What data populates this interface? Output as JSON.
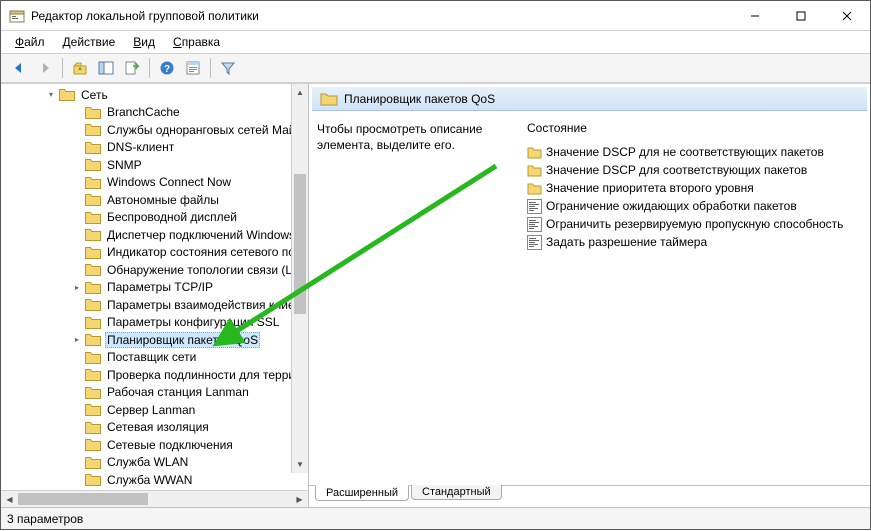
{
  "window": {
    "title": "Редактор локальной групповой политики"
  },
  "menu": {
    "file": "Файл",
    "action": "Действие",
    "view": "Вид",
    "help": "Справка"
  },
  "tree": {
    "root": "Сеть",
    "items": [
      "BranchCache",
      "Службы одноранговых сетей Май",
      "DNS-клиент",
      "SNMP",
      "Windows Connect Now",
      "Автономные файлы",
      "Беспроводной дисплей",
      "Диспетчер подключений Windows",
      "Индикатор состояния сетевого по",
      "Обнаружение топологии связи (L",
      "Параметры TCP/IP",
      "Параметры взаимодействия клиен",
      "Параметры конфигурации SSL",
      "Планировщик пакетов QoS",
      "Поставщик сети",
      "Проверка подлинности для терри",
      "Рабочая станция Lanman",
      "Сервер Lanman",
      "Сетевая изоляция",
      "Сетевые подключения",
      "Служба WLAN",
      "Служба WWAN"
    ],
    "expandable": [
      10,
      13
    ],
    "selected_index": 13
  },
  "right": {
    "header": "Планировщик пакетов QoS",
    "description": "Чтобы просмотреть описание элемента, выделите его.",
    "column_title": "Состояние",
    "items": [
      {
        "icon": "folder",
        "label": "Значение DSCP для не соответствующих пакетов"
      },
      {
        "icon": "folder",
        "label": "Значение DSCP для соответствующих пакетов"
      },
      {
        "icon": "folder",
        "label": "Значение приоритета второго уровня"
      },
      {
        "icon": "setting",
        "label": "Ограничение ожидающих обработки пакетов"
      },
      {
        "icon": "setting",
        "label": "Ограничить резервируемую пропускную способность"
      },
      {
        "icon": "setting",
        "label": "Задать разрешение таймера"
      }
    ],
    "tabs": {
      "extended": "Расширенный",
      "standard": "Стандартный"
    }
  },
  "status": {
    "text": "3 параметров"
  },
  "annotation": {
    "color": "#26b81e"
  }
}
